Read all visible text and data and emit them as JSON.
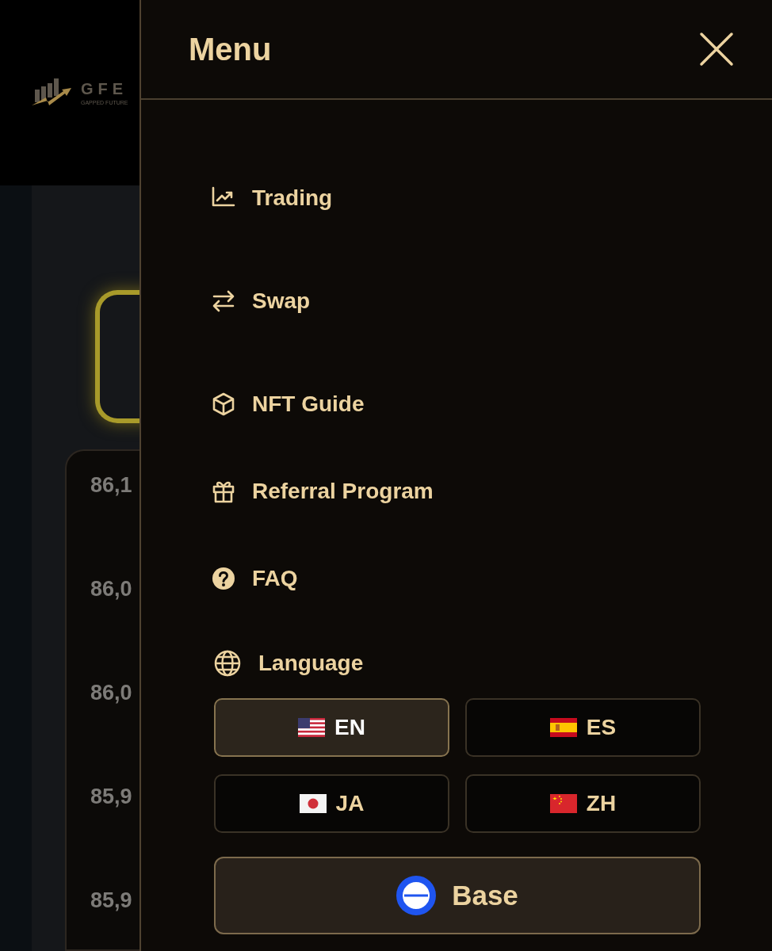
{
  "background": {
    "logo": {
      "name": "GFE",
      "tagline": "GAPPED FUTURE"
    },
    "price_axis": [
      "86,1",
      "86,0",
      "86,0",
      "85,9",
      "85,9"
    ]
  },
  "menu": {
    "title": "Menu",
    "items": [
      {
        "label": "Trading"
      },
      {
        "label": "Swap"
      },
      {
        "label": "NFT Guide"
      },
      {
        "label": "Referral Program"
      },
      {
        "label": "FAQ"
      }
    ],
    "language": {
      "label": "Language",
      "options": [
        {
          "code": "EN",
          "selected": true
        },
        {
          "code": "ES",
          "selected": false
        },
        {
          "code": "JA",
          "selected": false
        },
        {
          "code": "ZH",
          "selected": false
        }
      ]
    },
    "network": {
      "label": "Base"
    }
  }
}
